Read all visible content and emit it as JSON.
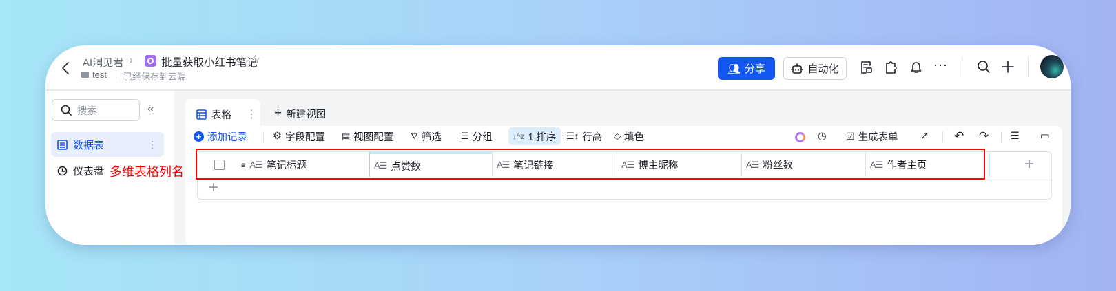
{
  "header": {
    "workspace": "AI洞见君",
    "doc_title": "批量获取小红书笔记",
    "folder": "test",
    "save_status": "已经保存到云端",
    "share_label": "分享",
    "automation_label": "自动化"
  },
  "sidebar": {
    "search_placeholder": "搜索",
    "items": [
      {
        "label": "数据表"
      },
      {
        "label": "仪表盘"
      }
    ]
  },
  "annotation": {
    "text": "多维表格列名",
    "color": "#ff0000"
  },
  "views": {
    "tabs": [
      {
        "label": "表格"
      }
    ],
    "new_view_label": "新建视图"
  },
  "toolbar": {
    "add_record": "添加记录",
    "field_config": "字段配置",
    "view_config": "视图配置",
    "filter": "筛选",
    "group": "分组",
    "sort": "1 排序",
    "row_height": "行高",
    "fill": "填色",
    "generate_form": "生成表单"
  },
  "table": {
    "columns": [
      {
        "label": "笔记标题"
      },
      {
        "label": "点赞数"
      },
      {
        "label": "笔记链接"
      },
      {
        "label": "博主昵称"
      },
      {
        "label": "粉丝数"
      },
      {
        "label": "作者主页"
      }
    ]
  },
  "colors": {
    "accent": "#1456f0",
    "annotation": "#ff0000"
  }
}
